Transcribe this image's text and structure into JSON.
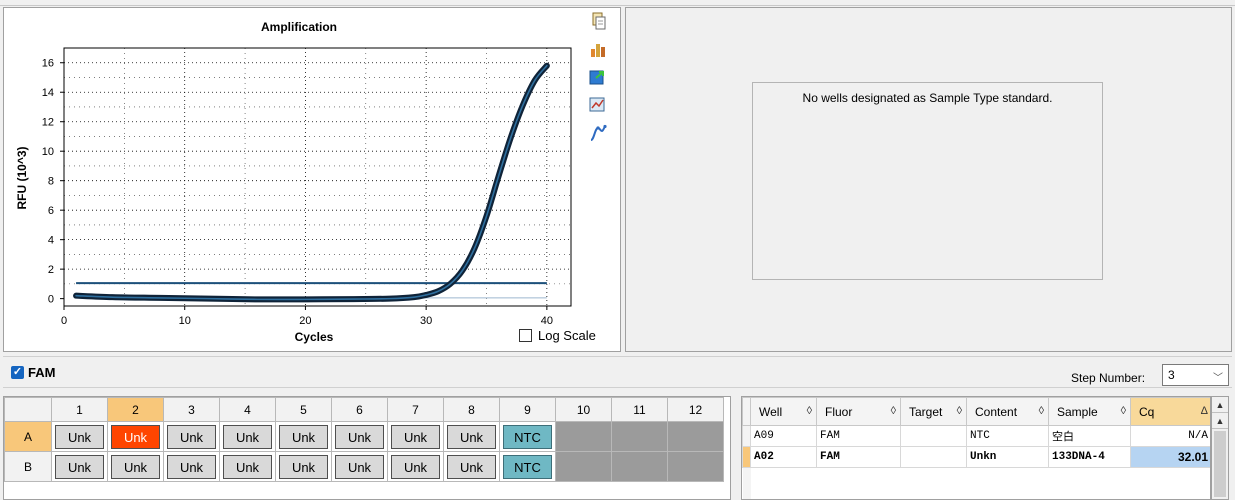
{
  "chart": {
    "title": "Amplification",
    "xlabel": "Cycles",
    "ylabel": "RFU (10^3)",
    "x_ticks": [
      "0",
      "10",
      "20",
      "30",
      "40"
    ],
    "y_ticks": [
      "0",
      "2",
      "4",
      "6",
      "8",
      "10",
      "12",
      "14",
      "16"
    ],
    "log_scale_label": "Log Scale",
    "log_scale_checked": false,
    "tools": [
      "copy-icon",
      "chart-properties-icon",
      "export-icon",
      "zoom-icon",
      "curve-icon"
    ]
  },
  "chart_data": {
    "type": "line",
    "title": "Amplification",
    "xlabel": "Cycles",
    "ylabel": "RFU (10^3)",
    "xlim": [
      0,
      42
    ],
    "ylim": [
      -0.5,
      17
    ],
    "grid": true,
    "threshold": 1.05,
    "series": [
      {
        "color": "#0f2338",
        "x": [
          1,
          4,
          8,
          12,
          16,
          20,
          24,
          27,
          29,
          30,
          31,
          32,
          33,
          34,
          35,
          36,
          37,
          38,
          39,
          40
        ],
        "y": [
          0.2,
          0.1,
          0.05,
          0.0,
          -0.05,
          -0.05,
          -0.03,
          0.0,
          0.1,
          0.25,
          0.5,
          1.0,
          1.9,
          3.4,
          5.6,
          8.3,
          10.9,
          13.1,
          14.8,
          15.8
        ]
      }
    ]
  },
  "standard_panel": {
    "message": "No wells designated as Sample Type standard."
  },
  "fluor_bar": {
    "fluor": "FAM",
    "fluor_checked": true,
    "step_label": "Step Number:",
    "step_value": "3"
  },
  "plate": {
    "columns": [
      "1",
      "2",
      "3",
      "4",
      "5",
      "6",
      "7",
      "8",
      "9",
      "10",
      "11",
      "12"
    ],
    "selected_column": "2",
    "rows": [
      {
        "label": "A",
        "selected": true,
        "wells": [
          "Unk",
          "Unk",
          "Unk",
          "Unk",
          "Unk",
          "Unk",
          "Unk",
          "Unk",
          "NTC",
          "",
          "",
          ""
        ]
      },
      {
        "label": "B",
        "selected": false,
        "wells": [
          "Unk",
          "Unk",
          "Unk",
          "Unk",
          "Unk",
          "Unk",
          "Unk",
          "Unk",
          "NTC",
          "",
          "",
          ""
        ]
      }
    ]
  },
  "results": {
    "headers": [
      "Well",
      "Fluor",
      "Target",
      "Content",
      "Sample",
      "Cq"
    ],
    "rows": [
      {
        "well": "A09",
        "fluor": "FAM",
        "target": "",
        "content": "NTC",
        "sample": "空白",
        "cq": "N/A",
        "selected": false
      },
      {
        "well": "A02",
        "fluor": "FAM",
        "target": "",
        "content": "Unkn",
        "sample": "133DNA-4",
        "cq": "32.01",
        "selected": true
      }
    ]
  },
  "colors": {
    "selected_well": "#ff4500",
    "ntc_well": "#6fb8c4",
    "unk_well": "#d9d9d9",
    "threshold_line": "#1c4f7a",
    "selected_header": "#f8c77a"
  }
}
